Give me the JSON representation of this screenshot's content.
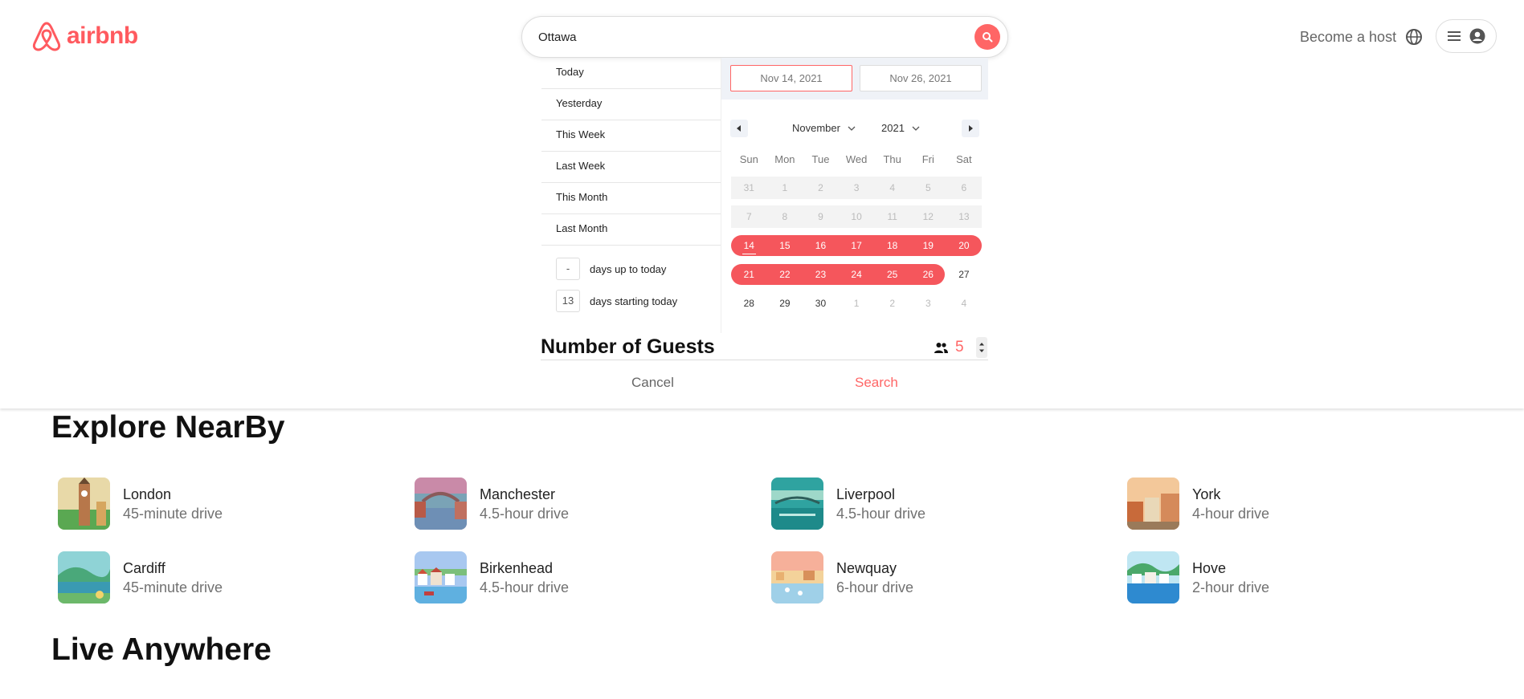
{
  "header": {
    "logo_text": "airbnb",
    "search_value": "Ottawa",
    "become_host": "Become a host"
  },
  "presets": [
    "Today",
    "Yesterday",
    "This Week",
    "Last Week",
    "This Month",
    "Last Month"
  ],
  "ranges": [
    {
      "value": "-",
      "label": "days up to today"
    },
    {
      "value": "13",
      "label": "days starting today"
    }
  ],
  "calendar": {
    "start_date": "Nov 14, 2021",
    "end_date": "Nov 26, 2021",
    "month": "November",
    "year": "2021",
    "weekdays": [
      "Sun",
      "Mon",
      "Tue",
      "Wed",
      "Thu",
      "Fri",
      "Sat"
    ],
    "weeks": [
      [
        "31",
        "1",
        "2",
        "3",
        "4",
        "5",
        "6"
      ],
      [
        "7",
        "8",
        "9",
        "10",
        "11",
        "12",
        "13"
      ],
      [
        "14",
        "15",
        "16",
        "17",
        "18",
        "19",
        "20"
      ],
      [
        "21",
        "22",
        "23",
        "24",
        "25",
        "26",
        "27"
      ],
      [
        "28",
        "29",
        "30",
        "1",
        "2",
        "3",
        "4"
      ]
    ]
  },
  "guests": {
    "title": "Number of Guests",
    "count": "5"
  },
  "actions": {
    "cancel": "Cancel",
    "search": "Search"
  },
  "explore": {
    "title": "Explore NearBy",
    "places": [
      {
        "name": "London",
        "distance": "45-minute drive"
      },
      {
        "name": "Manchester",
        "distance": "4.5-hour drive"
      },
      {
        "name": "Liverpool",
        "distance": "4.5-hour drive"
      },
      {
        "name": "York",
        "distance": "4-hour drive"
      },
      {
        "name": "Cardiff",
        "distance": "45-minute drive"
      },
      {
        "name": "Birkenhead",
        "distance": "4.5-hour drive"
      },
      {
        "name": "Newquay",
        "distance": "6-hour drive"
      },
      {
        "name": "Hove",
        "distance": "2-hour drive"
      }
    ]
  },
  "live_anywhere": {
    "title": "Live Anywhere"
  },
  "colors": {
    "brand": "#ff5a5f",
    "range": "#f5565c",
    "muted_text": "#717171"
  }
}
